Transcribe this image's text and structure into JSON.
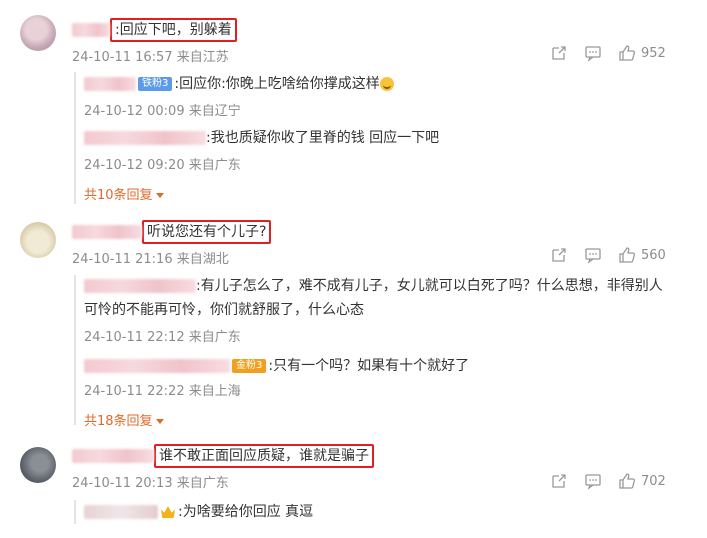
{
  "comments": [
    {
      "text": ":回应下吧，别躲着",
      "time": "24-10-11 16:57",
      "location": "来自江苏",
      "likes": "952",
      "replies": [
        {
          "badge": "铁粉3",
          "text": ":回应你:你晚上吃啥给你撑成这样",
          "time": "24-10-12 00:09",
          "location": "来自辽宁"
        },
        {
          "text": ":我也质疑你收了里脊的钱 回应一下吧",
          "time": "24-10-12 09:20",
          "location": "来自广东"
        }
      ],
      "more_label": "共10条回复"
    },
    {
      "text": "听说您还有个儿子?",
      "time": "24-10-11 21:16",
      "location": "来自湖北",
      "likes": "560",
      "replies": [
        {
          "text_line1": ":有儿子怎么了，难不成有儿子，女儿就可以白死了吗？什么思想，非得别人",
          "text_line2": "可怜的不能再可怜，你们就舒服了，什么心态",
          "time": "24-10-11 22:12",
          "location": "来自广东"
        },
        {
          "badge": "金粉3",
          "text": ":只有一个吗？如果有十个就好了",
          "time": "24-10-11 22:22",
          "location": "来自上海"
        }
      ],
      "more_label": "共18条回复"
    },
    {
      "text": "谁不敢正面回应质疑，谁就是骗子",
      "time": "24-10-11 20:13",
      "location": "来自广东",
      "likes": "702",
      "replies": [
        {
          "text": ":为啥要给你回应 真逗"
        }
      ]
    }
  ],
  "colors": {
    "highlight_border": "#e02020",
    "more_link": "#e06a2a",
    "meta": "#8c8c8c"
  }
}
